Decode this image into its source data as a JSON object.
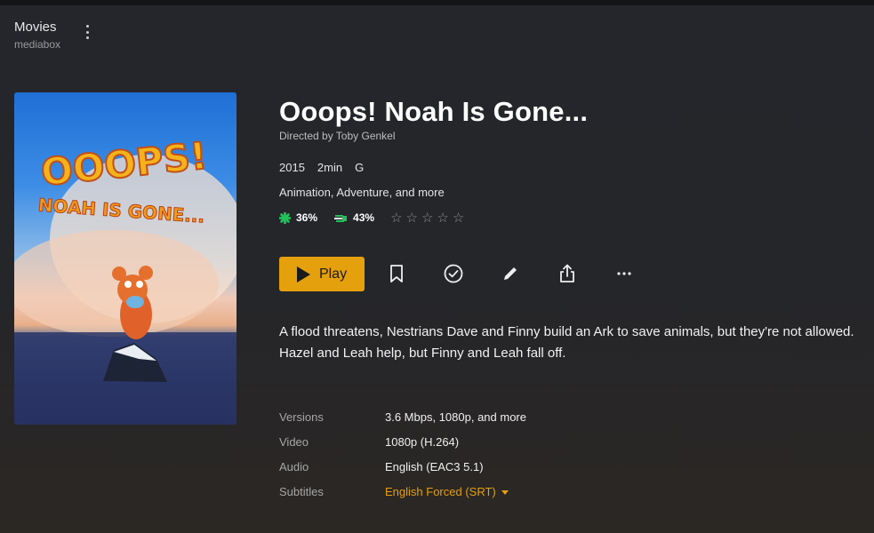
{
  "header": {
    "title": "Movies",
    "subtitle": "mediabox"
  },
  "poster": {
    "line1": "OOOPS!",
    "line2": "NOAH IS GONE..."
  },
  "movie": {
    "title": "Ooops! Noah Is Gone...",
    "director": "Directed by Toby Genkel",
    "year": "2015",
    "duration": "2min",
    "content_rating": "G",
    "genres": "Animation, Adventure, and more",
    "critic_rating": "36%",
    "audience_rating": "43%",
    "user_stars": 0,
    "description": "A flood threatens, Nestrians Dave and Finny build an Ark to save animals, but they're not allowed. Hazel and Leah help, but Finny and Leah fall off."
  },
  "actions": {
    "play_label": "Play",
    "icons": [
      "bookmark-icon",
      "check-circle-icon",
      "pencil-icon",
      "share-icon",
      "more-horizontal-icon"
    ]
  },
  "details": [
    {
      "label": "Versions",
      "value": "3.6 Mbps, 1080p, and more"
    },
    {
      "label": "Video",
      "value": "1080p (H.264)"
    },
    {
      "label": "Audio",
      "value": "English (EAC3 5.1)"
    },
    {
      "label": "Subtitles",
      "value": "English Forced (SRT)"
    }
  ],
  "colors": {
    "accent": "#e5a00d",
    "critic_green": "#21c05a"
  }
}
